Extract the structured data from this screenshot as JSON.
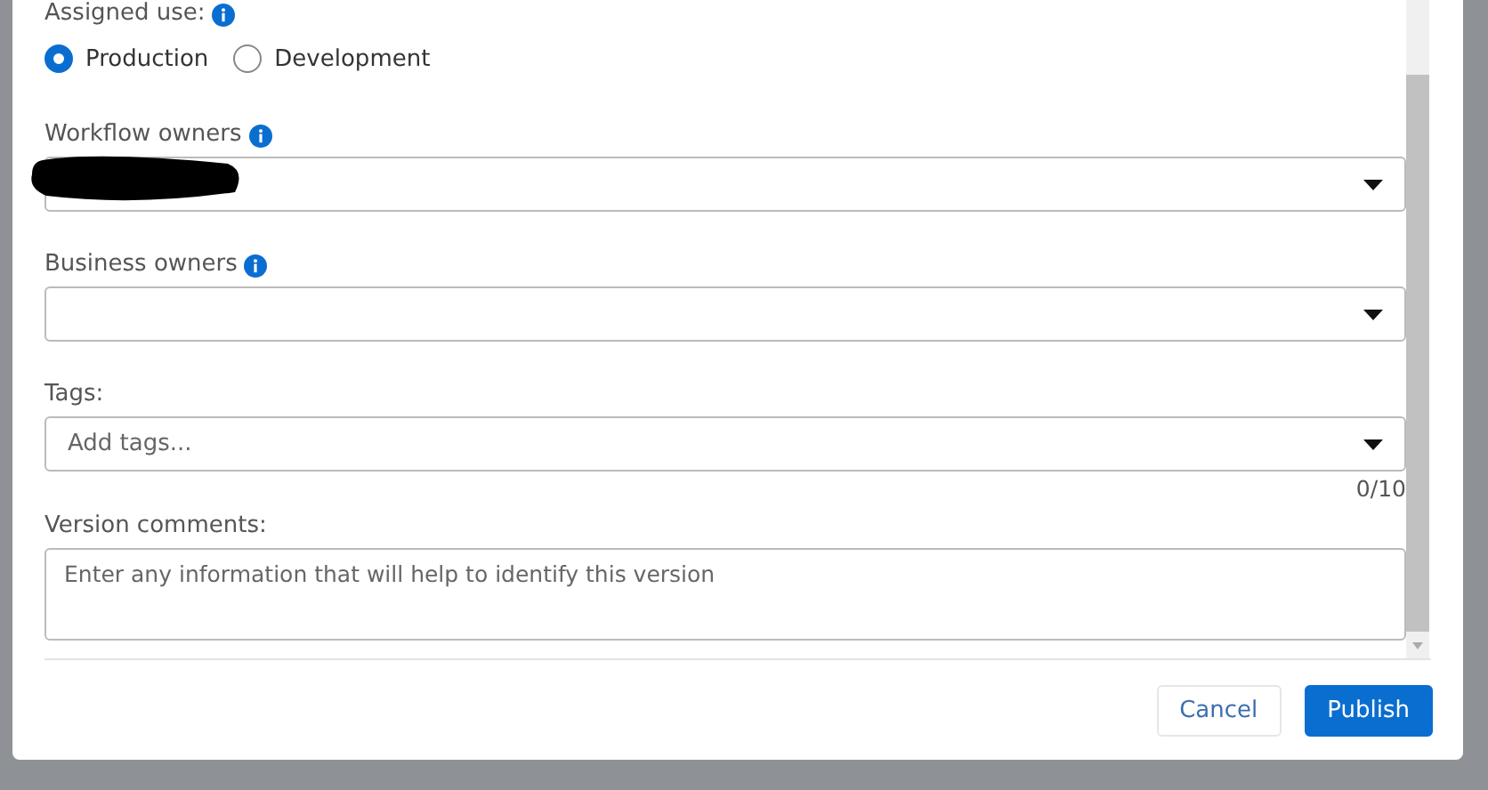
{
  "assigned_use": {
    "label": "Assigned use:",
    "options": [
      {
        "label": "Production",
        "selected": true
      },
      {
        "label": "Development",
        "selected": false
      }
    ]
  },
  "fields": [
    {
      "kind": "select",
      "label": "Workflow owners",
      "info": true,
      "redacted": true
    },
    {
      "kind": "select",
      "label": "Business owners",
      "info": true,
      "redacted": false
    },
    {
      "kind": "select",
      "label": "Tags:",
      "info": false,
      "placeholder": "Add tags...",
      "counter": "0/10"
    },
    {
      "kind": "textarea",
      "label": "Version comments:",
      "info": false,
      "placeholder": "Enter any information that will help to identify this version"
    }
  ],
  "buttons": [
    {
      "label": "Cancel",
      "primary": false
    },
    {
      "label": "Publish",
      "primary": true
    }
  ]
}
